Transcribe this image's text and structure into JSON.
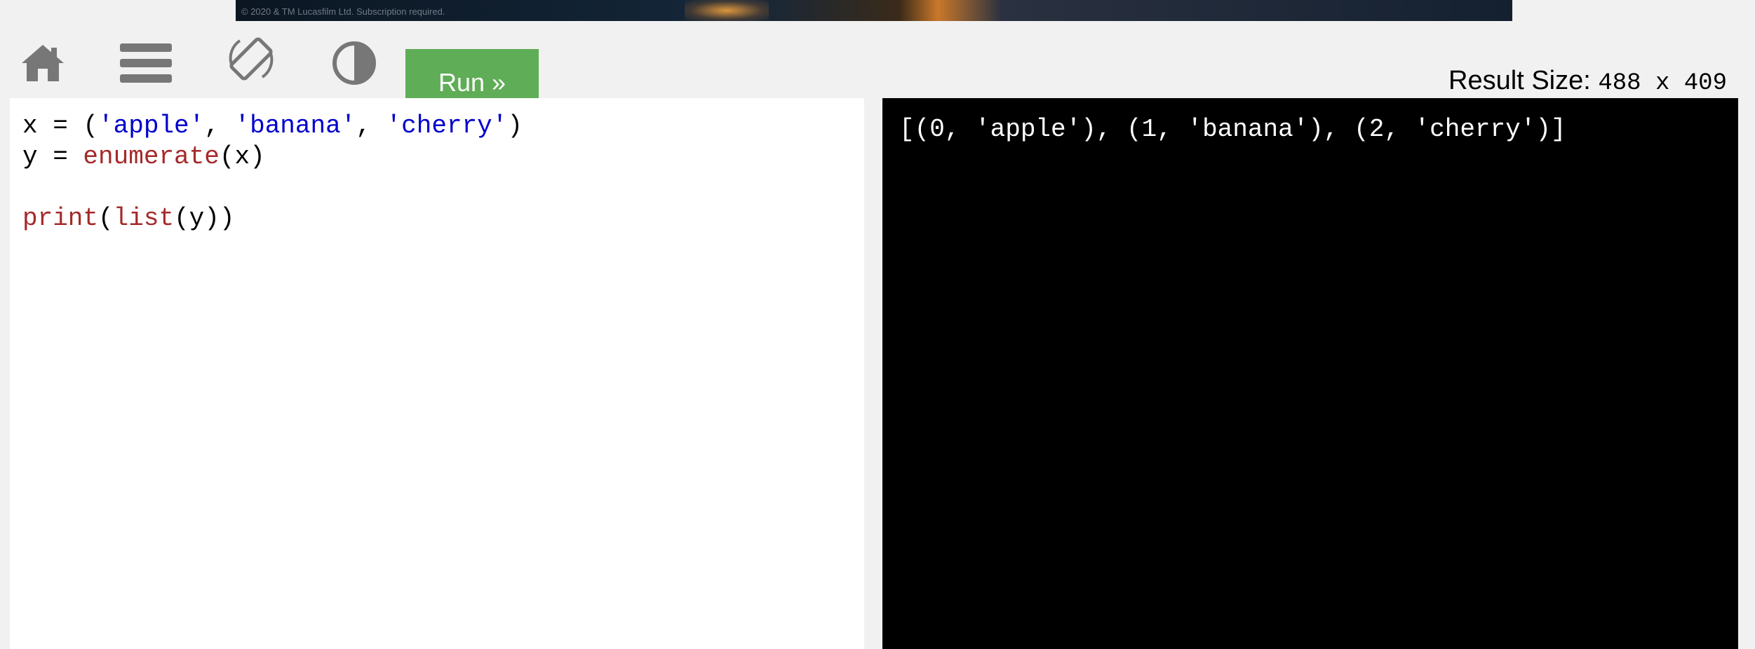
{
  "ad": {
    "copyright": "© 2020 & TM Lucasfilm Ltd. Subscription required."
  },
  "toolbar": {
    "icons": [
      "home-icon",
      "menu-icon",
      "rotate-icon",
      "contrast-icon"
    ],
    "run_label": "Run »",
    "run_color": "#5fad56",
    "result_size_label": "Result Size:",
    "result_size_value": "488 x 409"
  },
  "editor": {
    "lines": [
      {
        "tokens": [
          {
            "text": "x = (",
            "kind": "plain"
          },
          {
            "text": "'apple'",
            "kind": "str"
          },
          {
            "text": ", ",
            "kind": "plain"
          },
          {
            "text": "'banana'",
            "kind": "str"
          },
          {
            "text": ", ",
            "kind": "plain"
          },
          {
            "text": "'cherry'",
            "kind": "str"
          },
          {
            "text": ")",
            "kind": "plain"
          }
        ]
      },
      {
        "tokens": [
          {
            "text": "y = ",
            "kind": "plain"
          },
          {
            "text": "enumerate",
            "kind": "fn"
          },
          {
            "text": "(x)",
            "kind": "plain"
          }
        ]
      },
      {
        "tokens": []
      },
      {
        "tokens": [
          {
            "text": "print",
            "kind": "fn"
          },
          {
            "text": "(",
            "kind": "plain"
          },
          {
            "text": "list",
            "kind": "fn"
          },
          {
            "text": "(y))",
            "kind": "plain"
          }
        ]
      }
    ],
    "colors": {
      "string": "#0000cd",
      "function": "#a52a2a"
    }
  },
  "output": {
    "text": "[(0, 'apple'), (1, 'banana'), (2, 'cherry')]",
    "background": "#000000",
    "color": "#ffffff"
  }
}
